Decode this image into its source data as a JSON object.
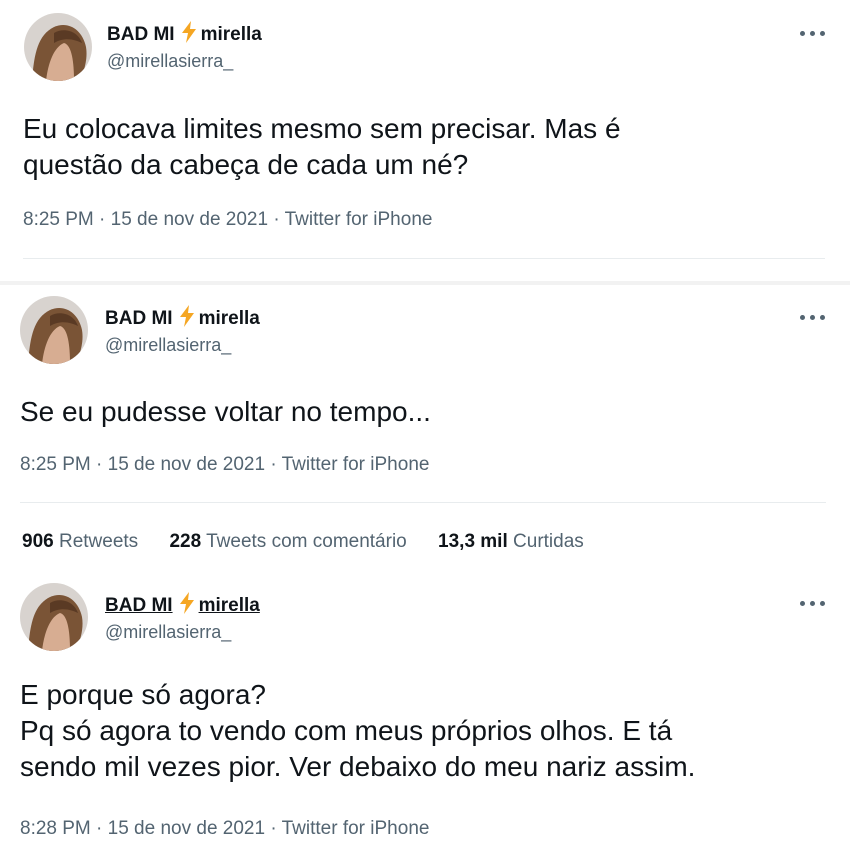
{
  "tweets": [
    {
      "display_name": "BAD MI",
      "display_name_suffix": "mirella",
      "handle": "@mirellasierra_",
      "text_lines": [
        "Eu colocava limites mesmo sem precisar. Mas é",
        "questão da cabeça de cada um né?"
      ],
      "meta": "8:25 PM · 15 de nov de 2021 · Twitter for iPhone",
      "more_icon": "ellipsis-icon"
    },
    {
      "display_name": "BAD MI",
      "display_name_suffix": "mirella",
      "handle": "@mirellasierra_",
      "text_lines": [
        "Se eu pudesse voltar no tempo..."
      ],
      "meta": "8:25 PM · 15 de nov de 2021 · Twitter for iPhone",
      "more_icon": "ellipsis-icon"
    },
    {
      "display_name": "BAD MI",
      "display_name_suffix": "mirella",
      "handle": "@mirellasierra_",
      "text_lines": [
        "E porque só agora?",
        "Pq só agora to vendo com meus próprios olhos. E tá",
        "sendo mil vezes pior. Ver debaixo do meu nariz assim."
      ],
      "meta": "8:28 PM · 15 de nov de 2021 · Twitter for iPhone",
      "more_icon": "ellipsis-icon"
    }
  ],
  "stats": {
    "retweets_count": "906",
    "retweets_label": "Retweets",
    "quotes_count": "228",
    "quotes_label": "Tweets com comentário",
    "likes_count": "13,3 mil",
    "likes_label": "Curtidas"
  },
  "colors": {
    "bolt": "#f5a623",
    "secondary_text": "#536471",
    "primary_text": "#0f1419"
  }
}
